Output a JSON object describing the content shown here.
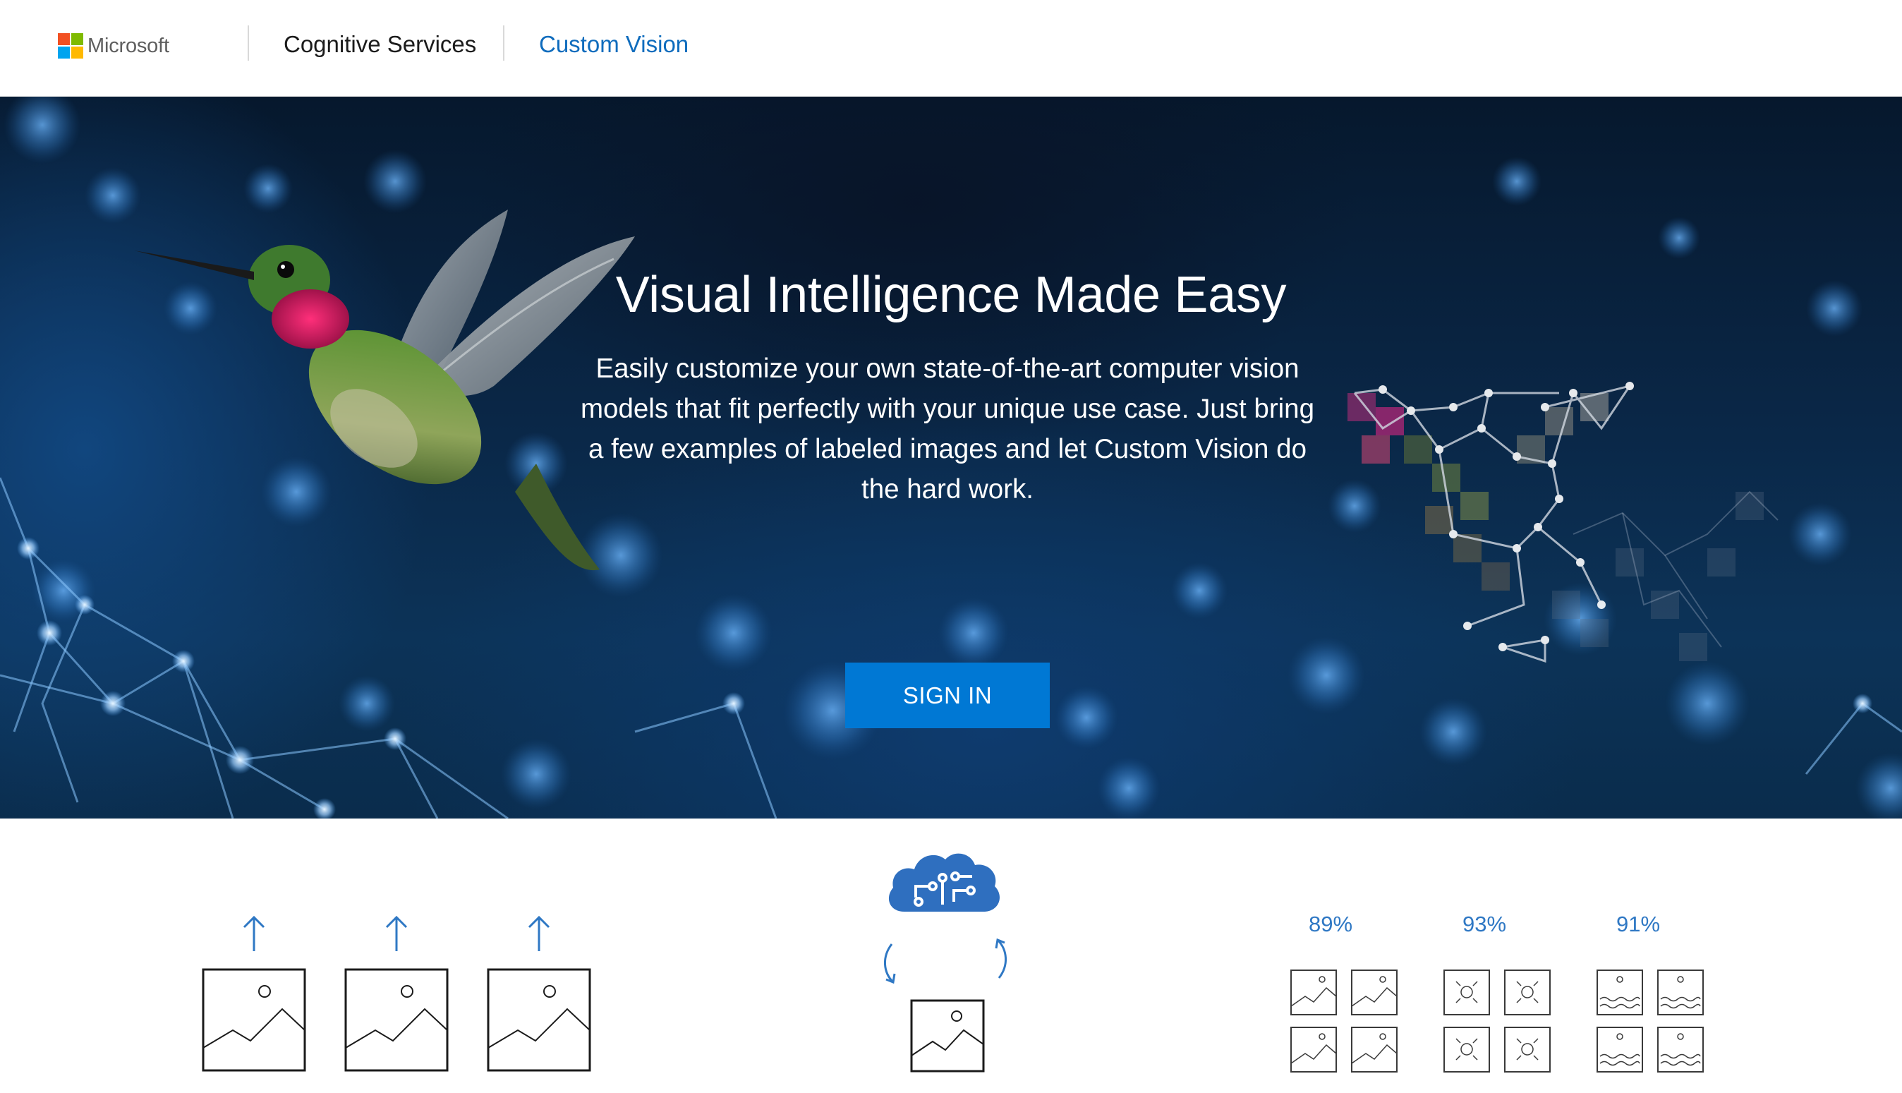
{
  "header": {
    "brand": "Microsoft",
    "brand_colors": [
      "#f25022",
      "#7fba00",
      "#00a4ef",
      "#ffb900"
    ],
    "nav": [
      {
        "label": "Cognitive Services",
        "active": false
      },
      {
        "label": "Custom Vision",
        "active": true
      }
    ],
    "accent": "#0f6cbd"
  },
  "hero": {
    "title": "Visual Intelligence Made Easy",
    "description": "Easily customize your own state-of-the-art computer vision models that fit perfectly with your unique use case. Just bring a few examples of labeled images and let Custom Vision do the hard work.",
    "cta_label": "SIGN IN",
    "cta_color": "#0078d4"
  },
  "features": {
    "upload": {
      "icons": [
        "upload-arrow-icon",
        "image-icon"
      ],
      "count": 3
    },
    "train": {
      "icons": [
        "brain-cloud-icon",
        "refresh-arrows-icon",
        "image-icon"
      ]
    },
    "predict": {
      "groups": [
        {
          "percent": "89%",
          "icon": "landscape-image-icon"
        },
        {
          "percent": "93%",
          "icon": "sun-image-icon"
        },
        {
          "percent": "91%",
          "icon": "water-image-icon"
        }
      ],
      "color": "#2f78c4"
    }
  }
}
